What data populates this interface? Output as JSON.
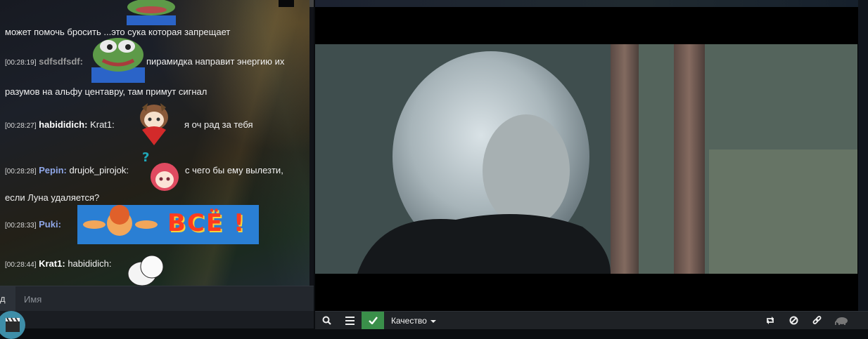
{
  "chat": {
    "partial_line": "может помочь бросить ...это сука которая запрещает",
    "messages": [
      {
        "time": "[00:28:19]",
        "nick": "sdfsdfsdf:",
        "text": "пирамидка направит энергию их",
        "text2": "разумов на альфу центавру, там примут сигнал"
      },
      {
        "time": "[00:28:27]",
        "nick": "habididich:",
        "text": "Krat1:",
        "text_after": "я оч рад за тебя"
      },
      {
        "time": "[00:28:28]",
        "nick": "Pepin:",
        "text": "drujok_pirojok:",
        "text_after": "с чего бы ему вылезти,",
        "text2": "если Луна удаляется?"
      },
      {
        "time": "[00:28:33]",
        "nick": "Puki:",
        "emote_text": "ВСЁ !"
      },
      {
        "time": "[00:28:44]",
        "nick": "Krat1:",
        "text": "habididich:"
      }
    ],
    "input_prefix": "д",
    "input_placeholder": "Имя"
  },
  "player": {
    "quality_label": "Качество"
  },
  "icons": {
    "search": "search-icon",
    "playlist": "list-icon",
    "check": "check-icon",
    "caret": "caret-down-icon",
    "repeat": "repeat-icon",
    "block": "ban-icon",
    "link": "link-icon",
    "elephant": "elephant-icon",
    "logo": "clapperboard-icon"
  },
  "colors": {
    "accent_green": "#3a8f4a",
    "nick_blue": "#8fa7e8",
    "nick_gray": "#9a9a9a"
  }
}
